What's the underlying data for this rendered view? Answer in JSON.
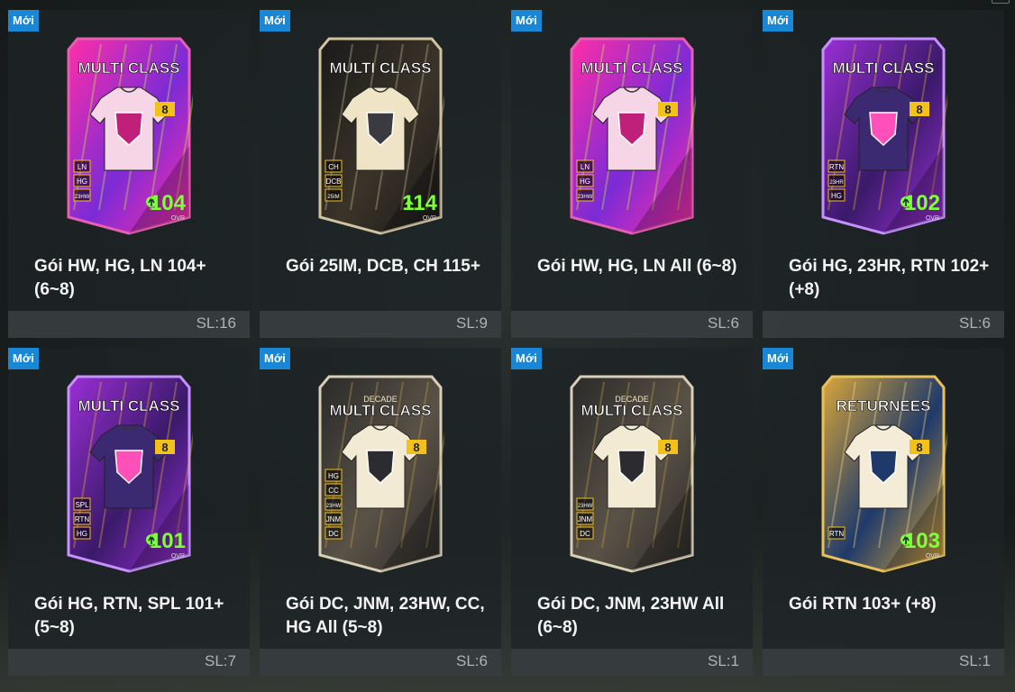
{
  "packs": [
    {
      "badge": "Mới",
      "title": "Gói HW, HG, LN 104+ (6~8)",
      "qty": "SL:16",
      "art": {
        "style": "mc",
        "header": "MULTI CLASS",
        "sub": "",
        "level": "8",
        "ovr": "104",
        "ovr_label": "OVR",
        "arrow": "circle",
        "tags": [
          "LN",
          "HG",
          "23HW"
        ],
        "c1": "#ff2ea8",
        "c2": "#7b2bd6",
        "c3": "#c6ff3a",
        "shirt": "#f6d6e6",
        "emblem": "#c0207a",
        "num": "#ffffff",
        "frame": "#e65fb0"
      }
    },
    {
      "badge": "Mới",
      "title": "Gói 25IM, DCB, CH 115+",
      "qty": "SL:9",
      "art": {
        "style": "dark",
        "header": "MULTI CLASS",
        "sub": "",
        "level": "",
        "ovr": "114",
        "ovr_label": "OVR",
        "arrow": "tri",
        "tags": [
          "CH",
          "DCB",
          "25IM"
        ],
        "c1": "#1a1a1a",
        "c2": "#3a3328",
        "c3": "#d2c19a",
        "shirt": "#efe4c6",
        "emblem": "#3b3a40",
        "num": "#7dff3a",
        "frame": "#cfc3a0"
      }
    },
    {
      "badge": "Mới",
      "title": "Gói HW, HG, LN All (6~8)",
      "qty": "SL:6",
      "art": {
        "style": "mc",
        "header": "MULTI CLASS",
        "sub": "",
        "level": "8",
        "ovr": "",
        "ovr_label": "",
        "arrow": "none",
        "tags": [
          "LN",
          "HG",
          "23HW"
        ],
        "c1": "#ff2ea8",
        "c2": "#7b2bd6",
        "c3": "#c6ff3a",
        "shirt": "#f6d6e6",
        "emblem": "#c0207a",
        "num": "#ffffff",
        "frame": "#e65fb0"
      }
    },
    {
      "badge": "Mới",
      "title": "Gói HG, 23HR, RTN 102+ (+8)",
      "qty": "SL:6",
      "art": {
        "style": "mc",
        "header": "MULTI CLASS",
        "sub": "",
        "level": "8",
        "ovr": "102",
        "ovr_label": "OVR",
        "arrow": "circle",
        "tags": [
          "RTN",
          "23HR",
          "HG"
        ],
        "c1": "#9b2fd6",
        "c2": "#3a1a6a",
        "c3": "#f2b33a",
        "shirt": "#3b2a72",
        "emblem": "#ff4fb8",
        "num": "#ffffff",
        "frame": "#c690ff"
      }
    },
    {
      "badge": "Mới",
      "title": "Gói HG, RTN, SPL 101+ (5~8)",
      "qty": "SL:7",
      "art": {
        "style": "mc",
        "header": "MULTI CLASS",
        "sub": "",
        "level": "8",
        "ovr": "101",
        "ovr_label": "OVR",
        "arrow": "circle",
        "tags": [
          "SPL",
          "RTN",
          "HG"
        ],
        "c1": "#9b2fd6",
        "c2": "#3a1a6a",
        "c3": "#f2b33a",
        "shirt": "#3b2a72",
        "emblem": "#ff4fb8",
        "num": "#ffffff",
        "frame": "#c690ff"
      }
    },
    {
      "badge": "Mới",
      "title": "Gói DC, JNM, 23HW, CC, HG All (5~8)",
      "qty": "SL:6",
      "art": {
        "style": "decade",
        "header": "MULTI CLASS",
        "sub": "DECADE",
        "level": "8",
        "ovr": "",
        "ovr_label": "",
        "arrow": "none",
        "tags": [
          "HG",
          "CC",
          "23HW",
          "JNM",
          "DC"
        ],
        "c1": "#2a2a2a",
        "c2": "#5a5246",
        "c3": "#c9a24a",
        "shirt": "#f2ead2",
        "emblem": "#2c2c30",
        "num": "#ffffff",
        "frame": "#d9cfb6"
      }
    },
    {
      "badge": "Mới",
      "title": "Gói DC, JNM, 23HW All (6~8)",
      "qty": "SL:1",
      "art": {
        "style": "decade",
        "header": "MULTI CLASS",
        "sub": "DECADE",
        "level": "8",
        "ovr": "",
        "ovr_label": "",
        "arrow": "none",
        "tags": [
          "23HW",
          "JNM",
          "DC"
        ],
        "c1": "#2a2a2a",
        "c2": "#5a5246",
        "c3": "#c9a24a",
        "shirt": "#f2ead2",
        "emblem": "#2c2c30",
        "num": "#ffffff",
        "frame": "#d9cfb6"
      }
    },
    {
      "badge": "Mới",
      "title": "Gói RTN 103+ (+8)",
      "qty": "SL:1",
      "art": {
        "style": "ret",
        "header": "RETURNEES",
        "sub": "",
        "level": "8",
        "ovr": "103",
        "ovr_label": "OVR",
        "arrow": "circle",
        "tags": [
          "RTN"
        ],
        "c1": "#d9a63a",
        "c2": "#1f3a6a",
        "c3": "#ffe08a",
        "shirt": "#f4ecd6",
        "emblem": "#1f3a6a",
        "num": "#ffffff",
        "frame": "#e8c15a"
      }
    }
  ]
}
